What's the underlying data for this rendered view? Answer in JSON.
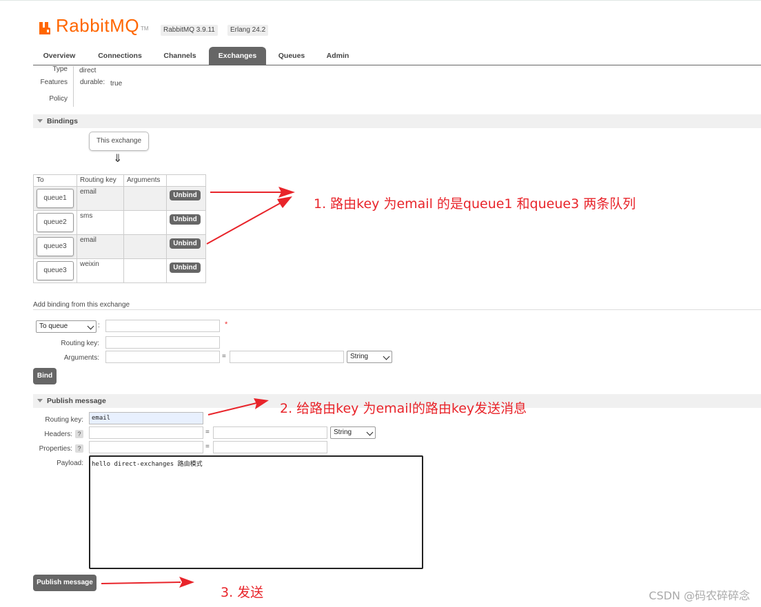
{
  "header": {
    "logo_text": "RabbitMQ",
    "logo_tm": "TM",
    "version": "RabbitMQ 3.9.11",
    "erlang": "Erlang 24.2",
    "brand_color": "#ff6600"
  },
  "tabs": [
    {
      "label": "Overview"
    },
    {
      "label": "Connections"
    },
    {
      "label": "Channels"
    },
    {
      "label": "Exchanges",
      "active": true
    },
    {
      "label": "Queues"
    },
    {
      "label": "Admin"
    }
  ],
  "details": {
    "type_label": "Type",
    "type_value": "direct",
    "features_label": "Features",
    "features_key": "durable:",
    "features_value": "true",
    "policy_label": "Policy"
  },
  "bindings": {
    "title": "Bindings",
    "this_exchange": "This exchange",
    "arrow": "⇓",
    "headers": [
      "To",
      "Routing key",
      "Arguments"
    ],
    "unbind_label": "Unbind",
    "rows": [
      {
        "queue": "queue1",
        "routing_key": "email"
      },
      {
        "queue": "queue2",
        "routing_key": "sms"
      },
      {
        "queue": "queue3",
        "routing_key": "email"
      },
      {
        "queue": "queue3",
        "routing_key": "weixin"
      }
    ]
  },
  "add_binding": {
    "title": "Add binding from this exchange",
    "to_select": "To queue",
    "colon": ":",
    "required_mark": "*",
    "routing_key_label": "Routing key:",
    "arguments_label": "Arguments:",
    "equals": "=",
    "type_select": "String",
    "bind_button": "Bind"
  },
  "publish": {
    "title": "Publish message",
    "routing_key_label": "Routing key:",
    "routing_key_value": "email",
    "headers_label": "Headers:",
    "properties_label": "Properties:",
    "hint": "?",
    "equals": "=",
    "type_select": "String",
    "payload_label": "Payload:",
    "payload_value": "hello  direct-exchanges 路由模式",
    "publish_button": "Publish message"
  },
  "annotations": {
    "note1": "1. 路由key 为email 的是queue1 和queue3 两条队列",
    "note2": "2. 给路由key 为email的路由key发送消息",
    "note3": "3. 发送",
    "color": "#e8242a"
  },
  "watermark": "CSDN @码农碎碎念"
}
